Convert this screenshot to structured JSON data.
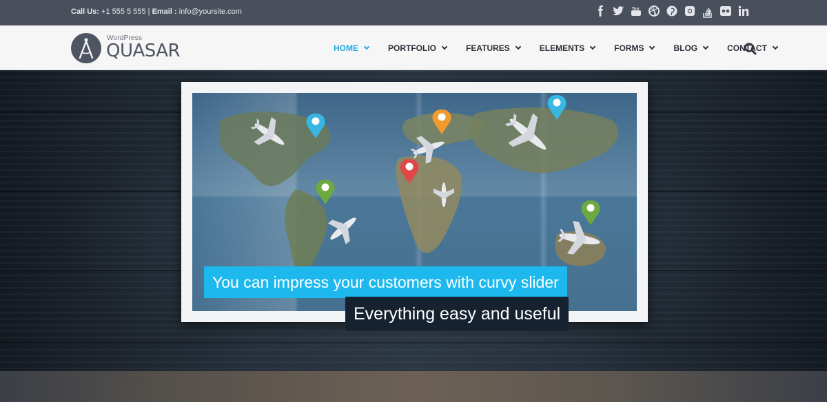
{
  "topbar": {
    "call_label": "Call Us:",
    "phone": "+1 555 5 555",
    "separator": "|",
    "email_label": "Email :",
    "email": "info@yoursite.com",
    "social": [
      "f",
      "t",
      "yt",
      "db",
      "p",
      "ig",
      "so",
      "fl",
      "in"
    ]
  },
  "logo": {
    "small": "WordPress",
    "name": "QUASAR"
  },
  "nav": {
    "items": [
      {
        "label": "HOME",
        "active": true
      },
      {
        "label": "PORTFOLIO"
      },
      {
        "label": "FEATURES"
      },
      {
        "label": "ELEMENTS"
      },
      {
        "label": "FORMS"
      },
      {
        "label": "BLOG"
      },
      {
        "label": "CONTACT"
      }
    ]
  },
  "slider": {
    "caption1": "You can impress your customers with curvy slider",
    "caption2": "Everything easy and useful"
  },
  "colors": {
    "topbar": "#4a4f5c",
    "accent": "#27a9e1",
    "caption_blue": "#1cb8ee",
    "caption_dark": "#172230",
    "pin_blue": "#38b7e3",
    "pin_orange": "#f29a2e",
    "pin_red": "#e04848",
    "pin_green": "#6da840"
  }
}
